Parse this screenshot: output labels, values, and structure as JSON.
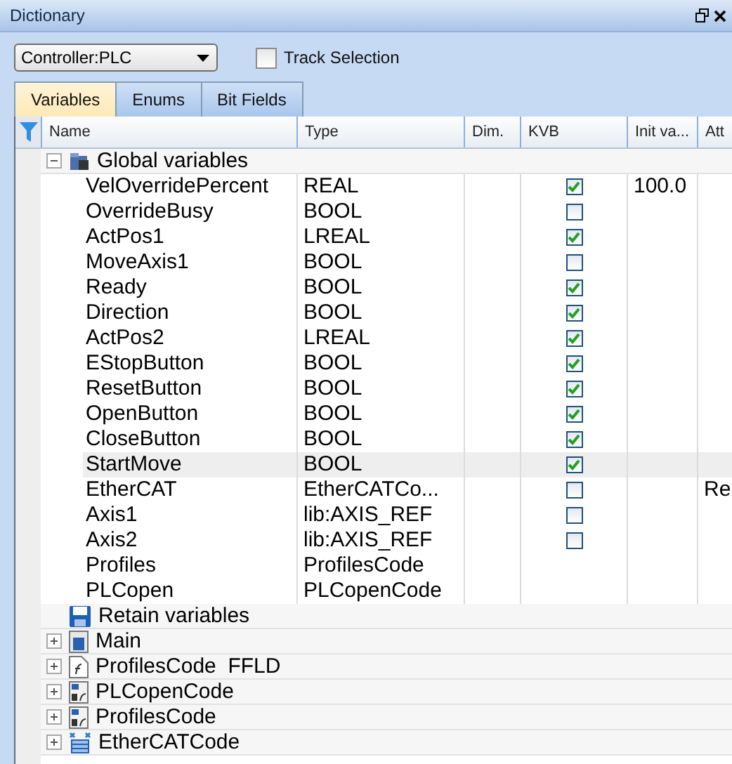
{
  "window": {
    "title": "Dictionary"
  },
  "controller": {
    "value": "Controller:PLC"
  },
  "track_selection": {
    "label": "Track Selection",
    "checked": false
  },
  "tabs": [
    {
      "label": "Variables",
      "selected": true
    },
    {
      "label": "Enums",
      "selected": false
    },
    {
      "label": "Bit Fields",
      "selected": false
    }
  ],
  "columns": [
    "Name",
    "Type",
    "Dim.",
    "KVB",
    "Init va...",
    "Att"
  ],
  "groups": [
    {
      "label": "Global variables",
      "kind": "globe",
      "expanded": true,
      "variables": [
        {
          "name": "VelOverridePercent",
          "type": "REAL",
          "kvb": true,
          "init": "100.0",
          "selected": false
        },
        {
          "name": "OverrideBusy",
          "type": "BOOL",
          "kvb": false,
          "selected": false
        },
        {
          "name": "ActPos1",
          "type": "LREAL",
          "kvb": true,
          "selected": false
        },
        {
          "name": "MoveAxis1",
          "type": "BOOL",
          "kvb": false,
          "selected": false
        },
        {
          "name": "Ready",
          "type": "BOOL",
          "kvb": true,
          "selected": false
        },
        {
          "name": "Direction",
          "type": "BOOL",
          "kvb": true,
          "selected": false
        },
        {
          "name": "ActPos2",
          "type": "LREAL",
          "kvb": true,
          "selected": false
        },
        {
          "name": "EStopButton",
          "type": "BOOL",
          "kvb": true,
          "selected": false
        },
        {
          "name": "ResetButton",
          "type": "BOOL",
          "kvb": true,
          "selected": false
        },
        {
          "name": "OpenButton",
          "type": "BOOL",
          "kvb": true,
          "selected": false
        },
        {
          "name": "CloseButton",
          "type": "BOOL",
          "kvb": true,
          "selected": false
        },
        {
          "name": "StartMove",
          "type": "BOOL",
          "kvb": true,
          "selected": true
        },
        {
          "name": "EtherCAT",
          "type": "EtherCATCo...",
          "kvb": false,
          "att": "Re",
          "selected": false
        },
        {
          "name": "Axis1",
          "type": "lib:AXIS_REF",
          "kvb": false,
          "selected": false
        },
        {
          "name": "Axis2",
          "type": "lib:AXIS_REF",
          "kvb": false,
          "selected": false
        },
        {
          "name": "Profiles",
          "type": "ProfilesCode",
          "selected": false
        },
        {
          "name": "PLCopen",
          "type": "PLCopenCode",
          "selected": false
        }
      ]
    },
    {
      "label": "Retain variables",
      "kind": "disk"
    },
    {
      "label": "Main",
      "kind": "program",
      "expanded": false
    },
    {
      "label": "ProfilesCode  FFLD",
      "kind": "function",
      "expanded": false
    },
    {
      "label": "PLCopenCode",
      "kind": "block",
      "expanded": false
    },
    {
      "label": "ProfilesCode",
      "kind": "block",
      "expanded": false
    },
    {
      "label": "EtherCATCode",
      "kind": "fieldbus",
      "expanded": false
    }
  ]
}
